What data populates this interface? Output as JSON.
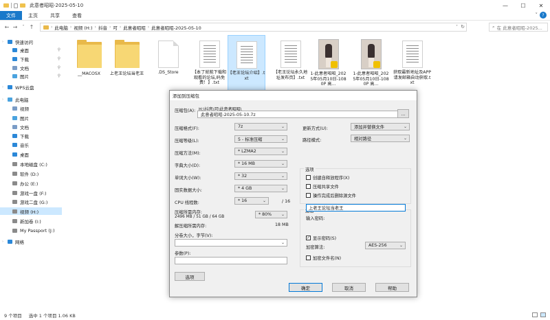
{
  "window": {
    "title": "此意者昭昭-2025-05-10",
    "minimize": "—",
    "maximize": "☐",
    "close": "✕"
  },
  "ribbon": {
    "tabs": [
      "文件",
      "主页",
      "共享",
      "查看"
    ],
    "expand": "˅",
    "help": "?"
  },
  "nav": {
    "back": "←",
    "forward": "→",
    "recent": "˅",
    "up": "↑",
    "path": [
      "此电脑",
      "视频 (H:)",
      "抖音",
      "可",
      "此意者昭昭",
      "此意者昭昭-2025-05-10"
    ],
    "dropdown": "˅",
    "refresh": "↻",
    "search_placeholder": "在 此意者昭昭-2025..."
  },
  "sidebar": {
    "items": [
      {
        "label": "快速访问",
        "icon": "star-icon",
        "color": "#2b88d8",
        "pinned": false
      },
      {
        "label": "桌面",
        "icon": "desktop-icon",
        "color": "#2b88d8",
        "pinned": true
      },
      {
        "label": "下载",
        "icon": "download-icon",
        "color": "#2b88d8",
        "pinned": true
      },
      {
        "label": "文档",
        "icon": "document-icon",
        "color": "#7a9cc6",
        "pinned": true
      },
      {
        "label": "图片",
        "icon": "pictures-icon",
        "color": "#4aa3df",
        "pinned": true
      },
      {
        "label": "WPS云盘",
        "icon": "cloud-icon",
        "color": "#2b88d8",
        "pinned": false
      },
      {
        "label": "此电脑",
        "icon": "computer-icon",
        "color": "#4aa3df",
        "pinned": false
      },
      {
        "label": "视频",
        "icon": "video-icon",
        "color": "#7a9cc6",
        "pinned": false
      },
      {
        "label": "图片",
        "icon": "pictures-icon",
        "color": "#4aa3df",
        "pinned": false
      },
      {
        "label": "文档",
        "icon": "document-icon",
        "color": "#7a9cc6",
        "pinned": false
      },
      {
        "label": "下载",
        "icon": "download-icon",
        "color": "#2b88d8",
        "pinned": false
      },
      {
        "label": "音乐",
        "icon": "music-icon",
        "color": "#2b88d8",
        "pinned": false
      },
      {
        "label": "桌面",
        "icon": "desktop-icon",
        "color": "#2b88d8",
        "pinned": false
      },
      {
        "label": "本地磁盘 (C:)",
        "icon": "drive-icon",
        "color": "#8a8a8a",
        "pinned": false
      },
      {
        "label": "软件 (D:)",
        "icon": "drive-icon",
        "color": "#8a8a8a",
        "pinned": false
      },
      {
        "label": "办公 (E:)",
        "icon": "drive-icon",
        "color": "#8a8a8a",
        "pinned": false
      },
      {
        "label": "游戏一盘 (F:)",
        "icon": "drive-icon",
        "color": "#8a8a8a",
        "pinned": false
      },
      {
        "label": "游戏二盘 (G:)",
        "icon": "drive-icon",
        "color": "#8a8a8a",
        "pinned": false
      },
      {
        "label": "视频 (H:)",
        "icon": "drive-icon",
        "color": "#8a8a8a",
        "pinned": false,
        "selected": true
      },
      {
        "label": "新加卷 (I:)",
        "icon": "drive-icon",
        "color": "#8a8a8a",
        "pinned": false
      },
      {
        "label": "My Passport (J:)",
        "icon": "drive-icon",
        "color": "#8a8a8a",
        "pinned": false
      },
      {
        "label": "网络",
        "icon": "network-icon",
        "color": "#2b88d8",
        "pinned": false
      }
    ]
  },
  "files": [
    {
      "name": "__MACOSX",
      "type": "folder"
    },
    {
      "name": "上老王论坛当老王",
      "type": "folder"
    },
    {
      "name": ".DS_Store",
      "type": "doc"
    },
    {
      "name": "【本了就能下载和观看的论坛,码免费！】.txt",
      "type": "txt"
    },
    {
      "name": "【老王论坛介绍】.txt",
      "type": "txt",
      "selected": true
    },
    {
      "name": "【老王论坛永久地址发布页】.txt",
      "type": "txt"
    },
    {
      "name": "1-此意者昭昭_2025年05月10日-1080P 高...",
      "type": "photo"
    },
    {
      "name": "1-此意者昭昭_2025年05月10日-1080P 高...",
      "type": "photo"
    },
    {
      "name": "获取最新地址及APP请发邮箱自动获取.txt",
      "type": "txt"
    }
  ],
  "status": {
    "count": "9 个项目",
    "selection": "选中 1 个项目  1.06 KB"
  },
  "dialog": {
    "title": "添加到压缩包",
    "archive_label": "压缩包(A):",
    "archive_path": "H:\\抖音\\可\\此意者昭昭\\",
    "archive_name": "此意者昭昭-2025-05-10.7z",
    "browse": "...",
    "left": [
      {
        "label": "压缩格式(F):",
        "value": "7z"
      },
      {
        "label": "压缩等级(L):",
        "value": "5 - 标准压缩"
      },
      {
        "label": "压缩方法(M):",
        "value": "* LZMA2"
      },
      {
        "label": "字典大小(D):",
        "value": "* 16 MB"
      },
      {
        "label": "单词大小(W):",
        "value": "* 32"
      },
      {
        "label": "固实数据大小:",
        "value": "* 4 GB"
      }
    ],
    "cpu_label": "CPU 线程数:",
    "cpu_value": "* 16",
    "cpu_total": "/ 16",
    "mem_label": "压缩所需内存:",
    "mem_detail": "2496 MB / 51 GB / 64 GB",
    "mem_pct": "* 80%",
    "unpack_label": "解压缩所需内存:",
    "unpack_value": "18 MB",
    "split_label": "分卷大小，字节(V):",
    "params_label": "参数(P):",
    "options_button": "选项",
    "update_label": "更新方式(U):",
    "update_value": "添加并替换文件",
    "pathmode_label": "路径模式:",
    "pathmode_value": "相对路径",
    "options_group": "选项",
    "opt_sfx": "创建自释放程序(X)",
    "opt_shared": "压缩共享文件",
    "opt_delete": "操作完成后删除源文件",
    "encrypt_group": "加密",
    "password_label": "输入密码:",
    "password_value": "上老王论坛当老王",
    "show_password": "显示密码(S)",
    "enc_method_label": "加密算法:",
    "enc_method_value": "AES-256",
    "encrypt_names": "加密文件名(N)",
    "ok": "确定",
    "cancel": "取消",
    "help": "帮助"
  }
}
